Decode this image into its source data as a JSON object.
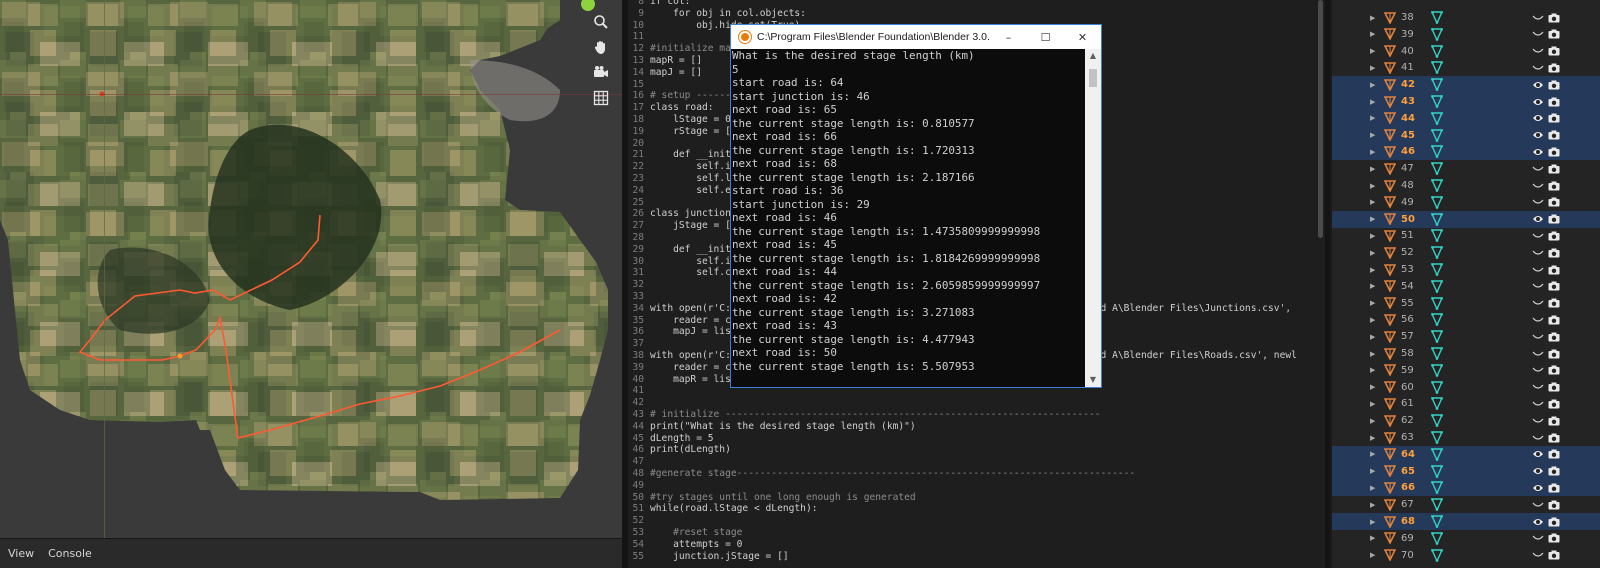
{
  "viewport": {
    "footer_menu": [
      "View",
      "Console"
    ],
    "gizmo_icons": [
      "zoom-icon",
      "hand-pan-icon",
      "camera-icon",
      "grid-icon"
    ]
  },
  "editor": {
    "lines": [
      {
        "n": "8",
        "t": "if col:",
        "c": false
      },
      {
        "n": "9",
        "t": "    for obj in col.objects:",
        "c": false
      },
      {
        "n": "10",
        "t": "        obj.hide_set(True)",
        "c": false
      },
      {
        "n": "11",
        "t": "",
        "c": false
      },
      {
        "n": "12",
        "t": "#initialize map",
        "c": true
      },
      {
        "n": "13",
        "t": "mapR = []",
        "c": false
      },
      {
        "n": "14",
        "t": "mapJ = []",
        "c": false
      },
      {
        "n": "15",
        "t": "",
        "c": false
      },
      {
        "n": "16",
        "t": "# setup ----------",
        "c": true
      },
      {
        "n": "17",
        "t": "class road:",
        "c": false
      },
      {
        "n": "18",
        "t": "    lStage = 0 #",
        "c": false
      },
      {
        "n": "19",
        "t": "    rStage = []",
        "c": false
      },
      {
        "n": "20",
        "t": "",
        "c": false
      },
      {
        "n": "21",
        "t": "    def __init__",
        "c": false
      },
      {
        "n": "22",
        "t": "        self.ind",
        "c": false
      },
      {
        "n": "23",
        "t": "        self.len",
        "c": false
      },
      {
        "n": "24",
        "t": "        self.end",
        "c": false
      },
      {
        "n": "25",
        "t": "",
        "c": false
      },
      {
        "n": "26",
        "t": "class junction:",
        "c": false
      },
      {
        "n": "27",
        "t": "    jStage = []",
        "c": false
      },
      {
        "n": "28",
        "t": "",
        "c": false
      },
      {
        "n": "29",
        "t": "    def __init__",
        "c": false
      },
      {
        "n": "30",
        "t": "        self.ind",
        "c": false
      },
      {
        "n": "31",
        "t": "        self.con",
        "c": false
      },
      {
        "n": "32",
        "t": "",
        "c": false
      },
      {
        "n": "33",
        "t": "",
        "c": false
      },
      {
        "n": "34",
        "t": "with open(r'C:\\U                                                     Heuvelland A\\Blender Files\\Junctions.csv',",
        "c": false
      },
      {
        "n": "35",
        "t": "    reader = csv",
        "c": false
      },
      {
        "n": "36",
        "t": "    mapJ = list(",
        "c": false
      },
      {
        "n": "37",
        "t": "",
        "c": false
      },
      {
        "n": "38",
        "t": "with open(r'C:\\U                                                     Heuvelland A\\Blender Files\\Roads.csv', newl",
        "c": false
      },
      {
        "n": "39",
        "t": "    reader = csv",
        "c": false
      },
      {
        "n": "40",
        "t": "    mapR = list(",
        "c": false
      },
      {
        "n": "41",
        "t": "",
        "c": false
      },
      {
        "n": "42",
        "t": "",
        "c": false
      },
      {
        "n": "43",
        "t": "# initialize -----------------------------------------------------------------",
        "c": true
      },
      {
        "n": "44",
        "t": "print(\"What is the desired stage length (km)\")",
        "c": false
      },
      {
        "n": "45",
        "t": "dLength = 5",
        "c": false
      },
      {
        "n": "46",
        "t": "print(dLength)",
        "c": false
      },
      {
        "n": "47",
        "t": "",
        "c": false
      },
      {
        "n": "48",
        "t": "#generate stage---------------------------------------------------------------------",
        "c": true
      },
      {
        "n": "49",
        "t": "",
        "c": false
      },
      {
        "n": "50",
        "t": "#try stages until one long enough is generated",
        "c": true
      },
      {
        "n": "51",
        "t": "while(road.lStage < dLength):",
        "c": false
      },
      {
        "n": "52",
        "t": "",
        "c": false
      },
      {
        "n": "53",
        "t": "    #reset stage",
        "c": true
      },
      {
        "n": "54",
        "t": "    attempts = 0",
        "c": false
      },
      {
        "n": "55",
        "t": "    junction.jStage = []",
        "c": false
      }
    ]
  },
  "console": {
    "title": "C:\\Program Files\\Blender Foundation\\Blender 3.0...",
    "controls": [
      "–",
      "☐",
      "✕"
    ],
    "lines": [
      "What is the desired stage length (km)",
      "5",
      "start road is: 64",
      "start junction is: 46",
      "next road is: 65",
      "the current stage length is: 0.810577",
      "next road is: 66",
      "the current stage length is: 1.720313",
      "next road is: 68",
      "the current stage length is: 2.187166",
      "start road is: 36",
      "start junction is: 29",
      "next road is: 46",
      "the current stage length is: 1.4735809999999998",
      "next road is: 45",
      "the current stage length is: 1.8184269999999998",
      "next road is: 44",
      "the current stage length is: 2.6059859999999997",
      "next road is: 42",
      "the current stage length is: 3.271083",
      "next road is: 43",
      "the current stage length is: 4.477943",
      "next road is: 50",
      "the current stage length is: 5.507953"
    ]
  },
  "outliner": {
    "rows": [
      {
        "name": "38",
        "sel": false
      },
      {
        "name": "39",
        "sel": false
      },
      {
        "name": "40",
        "sel": false
      },
      {
        "name": "41",
        "sel": false
      },
      {
        "name": "42",
        "sel": true
      },
      {
        "name": "43",
        "sel": true
      },
      {
        "name": "44",
        "sel": true
      },
      {
        "name": "45",
        "sel": true
      },
      {
        "name": "46",
        "sel": true
      },
      {
        "name": "47",
        "sel": false
      },
      {
        "name": "48",
        "sel": false
      },
      {
        "name": "49",
        "sel": false
      },
      {
        "name": "50",
        "sel": true
      },
      {
        "name": "51",
        "sel": false
      },
      {
        "name": "52",
        "sel": false
      },
      {
        "name": "53",
        "sel": false
      },
      {
        "name": "54",
        "sel": false
      },
      {
        "name": "55",
        "sel": false
      },
      {
        "name": "56",
        "sel": false
      },
      {
        "name": "57",
        "sel": false
      },
      {
        "name": "58",
        "sel": false
      },
      {
        "name": "59",
        "sel": false
      },
      {
        "name": "60",
        "sel": false
      },
      {
        "name": "61",
        "sel": false
      },
      {
        "name": "62",
        "sel": false
      },
      {
        "name": "63",
        "sel": false
      },
      {
        "name": "64",
        "sel": true
      },
      {
        "name": "65",
        "sel": true
      },
      {
        "name": "66",
        "sel": true
      },
      {
        "name": "67",
        "sel": false
      },
      {
        "name": "68",
        "sel": true
      },
      {
        "name": "69",
        "sel": false
      },
      {
        "name": "70",
        "sel": false
      }
    ]
  },
  "colors": {
    "selection_bg": "#253a5a",
    "selected_text": "#ff9f3c",
    "road_path": "#ff5a32",
    "mesh_orange": "#e0823c",
    "modifier_cyan": "#34d2c4"
  }
}
